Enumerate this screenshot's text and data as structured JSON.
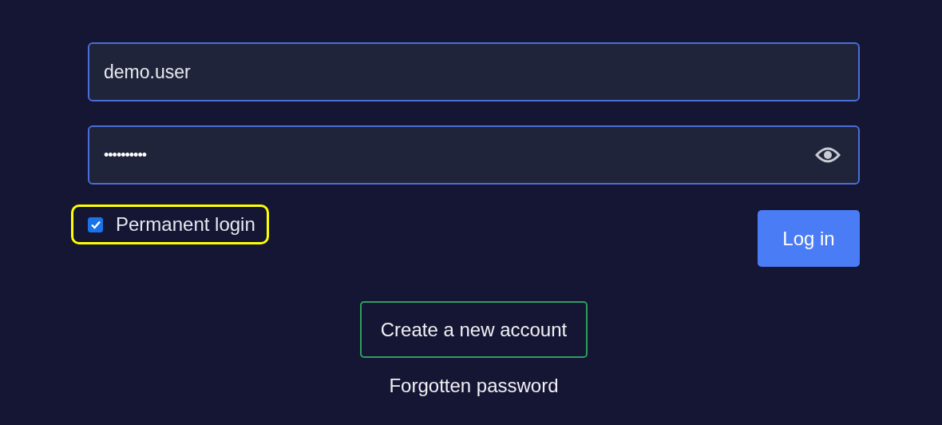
{
  "username": {
    "value": "demo.user"
  },
  "password": {
    "value": "••••••••••"
  },
  "permanent_login": {
    "label": "Permanent login",
    "checked": true,
    "highlighted": true
  },
  "login_button": {
    "label": "Log in"
  },
  "create_account_button": {
    "label": "Create a new account"
  },
  "forgotten_password_link": {
    "label": "Forgotten password"
  }
}
